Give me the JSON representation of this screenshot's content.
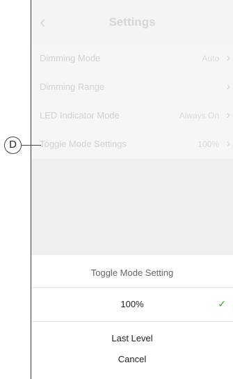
{
  "header": {
    "title": "Settings",
    "back_icon": "chevron-left-icon"
  },
  "settings": [
    {
      "label": "Dimming Mode",
      "value": "Auto"
    },
    {
      "label": "Dimming Range",
      "value": ""
    },
    {
      "label": "LED Indicator Mode",
      "value": "Always On"
    },
    {
      "label": "Toggle Mode Settings",
      "value": "100%"
    }
  ],
  "sheet": {
    "title": "Toggle Mode Setting",
    "options": [
      {
        "label": "100%",
        "selected": true
      },
      {
        "label": "Last Level",
        "selected": false
      },
      {
        "label": "Cancel",
        "selected": false
      }
    ]
  },
  "callout": {
    "label": "D"
  },
  "colors": {
    "check": "#3dae2b"
  }
}
